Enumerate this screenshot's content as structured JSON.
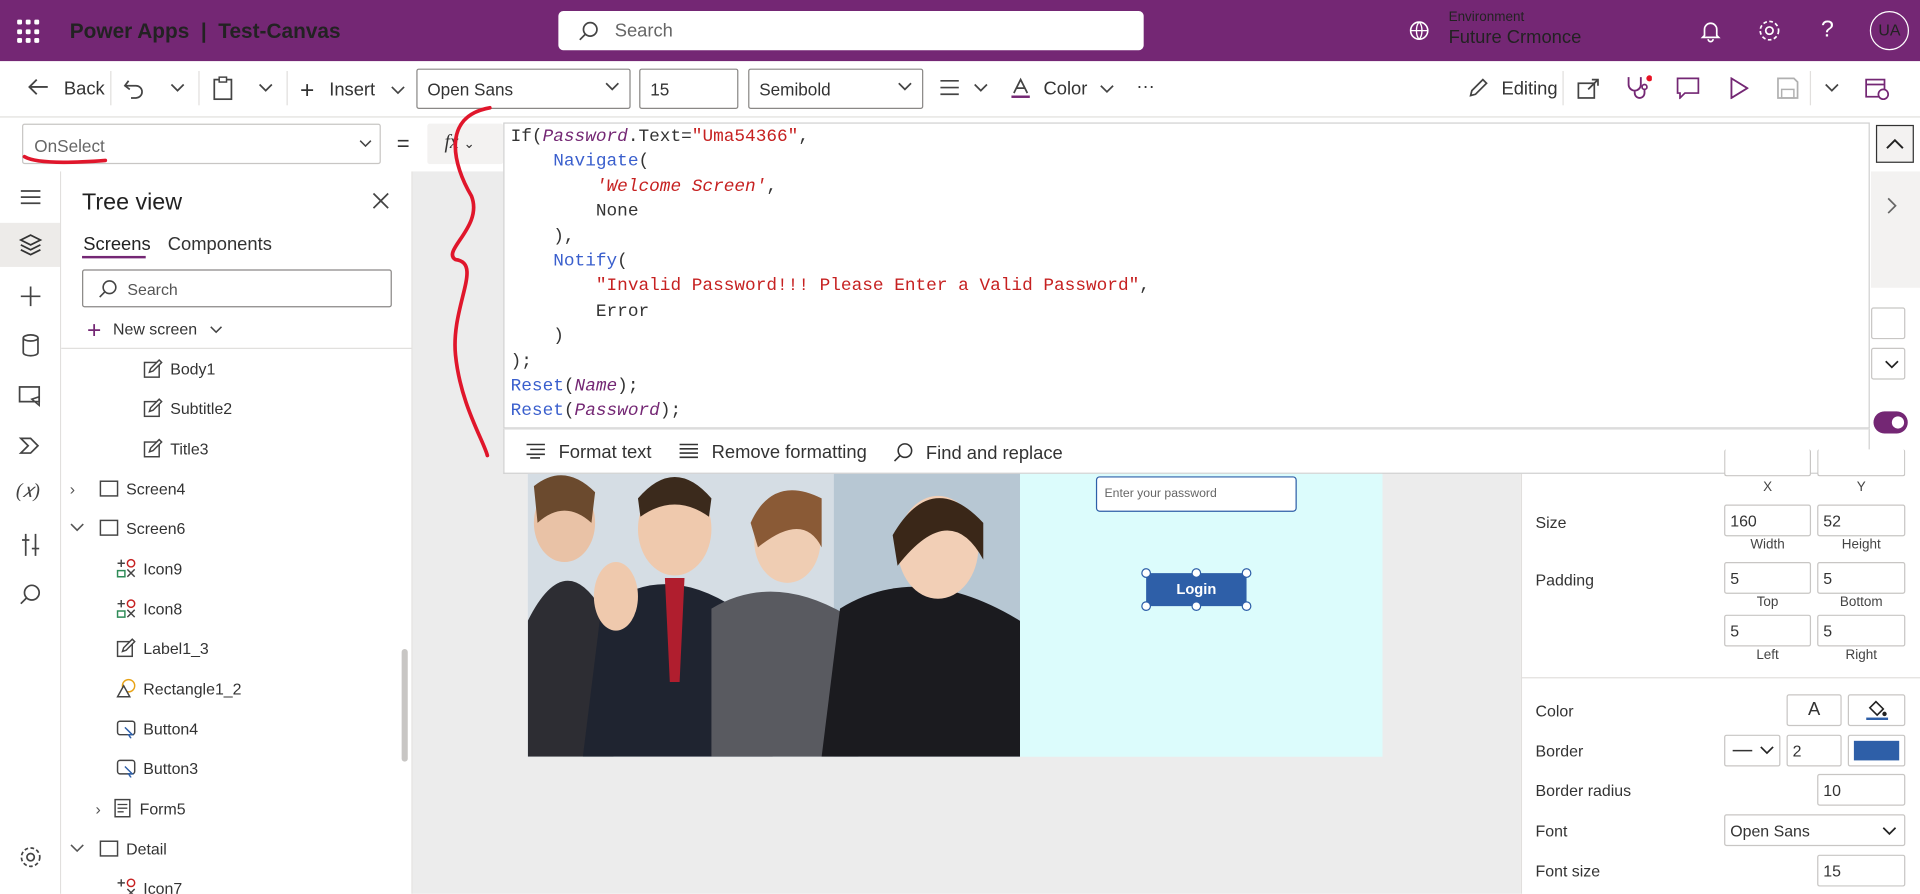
{
  "topbar": {
    "app_name": "Power Apps",
    "separator": "|",
    "app_title": "Test-Canvas",
    "search_placeholder": "Search",
    "environment_label": "Environment",
    "environment_name": "Future Crmonce",
    "avatar_initials": "UA",
    "bg_color": "#742774"
  },
  "commandbar": {
    "back": "Back",
    "insert": "Insert",
    "font": "Open Sans",
    "font_size": "15",
    "font_weight": "Semibold",
    "color": "Color",
    "more": "···",
    "editing": "Editing"
  },
  "formula": {
    "property": "OnSelect",
    "equals": "=",
    "fx": "fx",
    "code_lines": [
      "If(Password.Text=\"Uma54366\",",
      "    Navigate(",
      "        'Welcome Screen',",
      "        None",
      "    ),",
      "    Notify(",
      "        \"Invalid Password!!! Please Enter a Valid Password\",",
      "        Error",
      "    )",
      ");",
      "Reset(Name);",
      "Reset(Password);"
    ],
    "footer": {
      "format_text": "Format text",
      "remove_formatting": "Remove formatting",
      "find_replace": "Find and replace"
    }
  },
  "tree": {
    "title": "Tree view",
    "tab_screens": "Screens",
    "tab_components": "Components",
    "search_placeholder": "Search",
    "new_screen": "New screen",
    "nodes": [
      {
        "label": "Body1",
        "icon": "edit-label-icon"
      },
      {
        "label": "Subtitle2",
        "icon": "edit-label-icon"
      },
      {
        "label": "Title3",
        "icon": "edit-label-icon"
      },
      {
        "label": "Screen4",
        "icon": "screen-icon"
      },
      {
        "label": "Screen6",
        "icon": "screen-icon"
      },
      {
        "label": "Icon9",
        "icon": "icon-control-icon"
      },
      {
        "label": "Icon8",
        "icon": "icon-control-icon"
      },
      {
        "label": "Label1_3",
        "icon": "edit-label-icon"
      },
      {
        "label": "Rectangle1_2",
        "icon": "shape-icon"
      },
      {
        "label": "Button4",
        "icon": "button-icon"
      },
      {
        "label": "Button3",
        "icon": "button-icon"
      },
      {
        "label": "Form5",
        "icon": "form-icon"
      },
      {
        "label": "Detail",
        "icon": "screen-icon"
      },
      {
        "label": "Icon7",
        "icon": "icon-control-icon"
      }
    ]
  },
  "canvas": {
    "password_placeholder": "Enter your password",
    "login_label": "Login",
    "accent": "#2e5fa8",
    "panel_color": "#dcfcfc"
  },
  "properties": {
    "x_label": "X",
    "y_label": "Y",
    "size_label": "Size",
    "width_value": "160",
    "height_value": "52",
    "width_label": "Width",
    "height_label": "Height",
    "padding_label": "Padding",
    "padding_top": "5",
    "padding_bottom": "5",
    "padding_left": "5",
    "padding_right": "5",
    "top_label": "Top",
    "bottom_label": "Bottom",
    "left_label": "Left",
    "right_label": "Right",
    "color_label": "Color",
    "color_text_glyph": "A",
    "border_label": "Border",
    "border_width": "2",
    "border_radius_label": "Border radius",
    "border_radius_value": "10",
    "font_label": "Font",
    "font_value": "Open Sans",
    "font_size_label": "Font size",
    "font_size_value": "15"
  }
}
